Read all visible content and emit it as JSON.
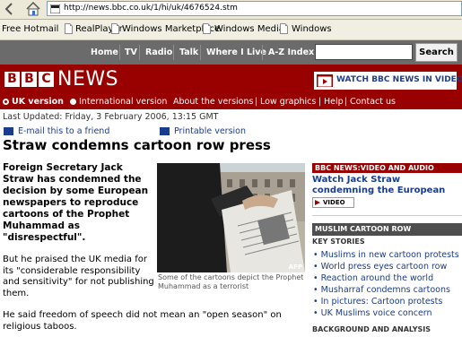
{
  "browser": {
    "address": "http://news.bbc.co.uk/1/hi/uk/4676524.stm",
    "links": [
      "Free Hotmail",
      "RealPlayer",
      "Windows Marketplace",
      "Windows Media",
      "Windows"
    ]
  },
  "topnav": {
    "items": [
      "Home",
      "TV",
      "Radio",
      "Talk",
      "Where I Live",
      "A-Z Index"
    ],
    "search_label": "Search"
  },
  "masthead": {
    "logo_letters": [
      "B",
      "B",
      "C"
    ],
    "news_word": "NEWS",
    "watch_label": "WATCH BBC NEWS IN VIDEO"
  },
  "versions": {
    "uk": "UK version",
    "international": "International version",
    "about": "About the versions",
    "sep1": "|",
    "low_graphics": "Low graphics",
    "sep2": "|",
    "help": "Help",
    "sep3": "|",
    "contact": "Contact us"
  },
  "article": {
    "updated": "Last Updated: Friday, 3 February 2006, 13:15 GMT",
    "email_link": "E-mail this to a friend",
    "print_link": "Printable version",
    "headline": "Straw condemns cartoon row press",
    "lead": "Foreign Secretary Jack Straw has condemned the decision by some European newspapers to reproduce cartoons of the Prophet Muhammad as \"disrespectful\".",
    "para1": "But he praised the UK media for its \"considerable responsibility and sensitivity\" for not publishing them.",
    "para2": "He said freedom of speech did not mean an \"open season\" on religious taboos.",
    "caption": "Some of the cartoons depict the Prophet Muhammad as a terrorist",
    "photo_credit": "AFP"
  },
  "sidebar": {
    "video_header": "BBC NEWS:VIDEO AND AUDIO",
    "video_link": "Watch Jack Straw condemning the European press",
    "video_badge": "VIDEO",
    "cartoon_header": "MUSLIM CARTOON ROW",
    "key_stories": "KEY STORIES",
    "stories": [
      "Muslims in new cartoon protests",
      "World press eyes cartoon row",
      "Reaction around the world",
      "Musharraf condemns cartoons",
      "In pictures: Cartoon protests",
      "UK Muslims voice concern"
    ],
    "background_header": "BACKGROUND AND ANALYSIS"
  },
  "colors": {
    "bbc_red": "#990000",
    "nav_grey": "#6b6b6b",
    "link_blue": "#1a3c8c"
  }
}
